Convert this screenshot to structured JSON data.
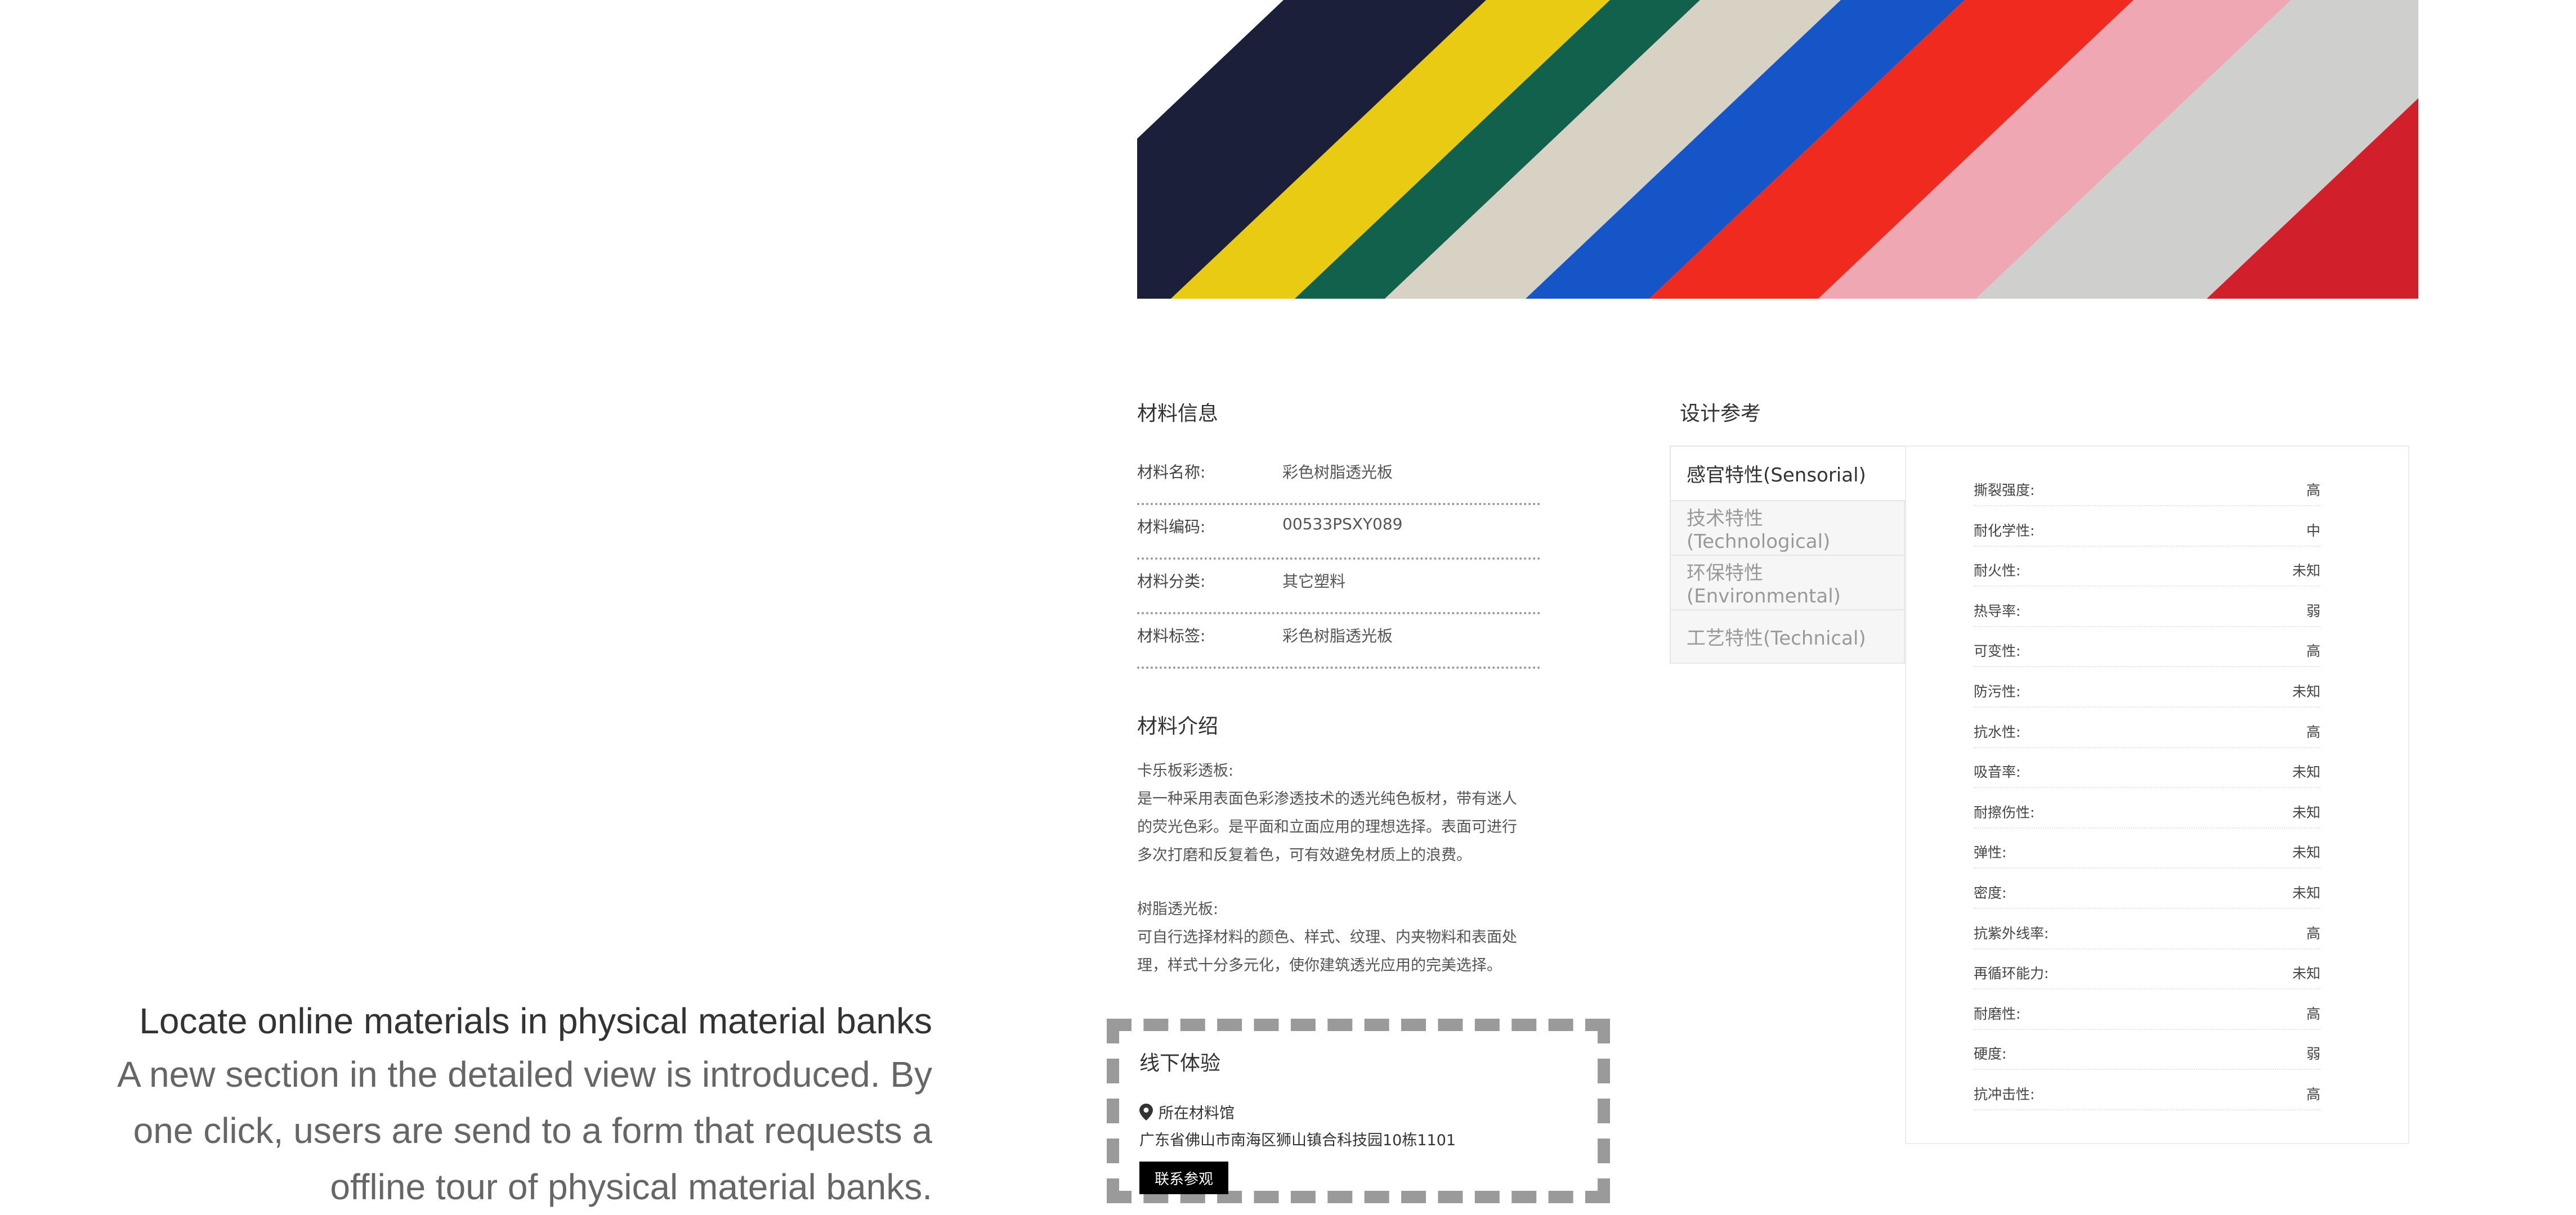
{
  "caption": {
    "title": "Locate online materials in physical material banks",
    "lines": [
      "A new section in the detailed view is introduced. By",
      "one click, users are send to a form that requests a",
      "offline tour of physical material banks."
    ]
  },
  "hero": {
    "stripe_colors": [
      "#1c1f3a",
      "#e9cb13",
      "#12614c",
      "#d7d2c4",
      "#1655c8",
      "#f12a1f",
      "#f0a7b4",
      "#cfd0cd",
      "#d21f2c"
    ]
  },
  "material_info": {
    "title": "材料信息",
    "rows": [
      {
        "label": "材料名称:",
        "value": "彩色树脂透光板"
      },
      {
        "label": "材料编码:",
        "value": "00533PSXY089"
      },
      {
        "label": "材料分类:",
        "value": "其它塑料"
      },
      {
        "label": "材料标签:",
        "value": "彩色树脂透光板"
      }
    ]
  },
  "material_intro": {
    "title": "材料介绍",
    "paragraphs": [
      [
        "卡乐板彩透板:",
        "是一种采用表面色彩渗透技术的透光纯色板材，带有迷人",
        "的荧光色彩。是平面和立面应用的理想选择。表面可进行",
        "多次打磨和反复着色，可有效避免材质上的浪费。"
      ],
      [
        "树脂透光板:",
        "可自行选择材料的颜色、样式、纹理、内夹物料和表面处",
        "理，样式十分多元化，使你建筑透光应用的完美选择。"
      ]
    ]
  },
  "offline": {
    "title": "线下体验",
    "location_label": "所在材料馆",
    "address": "广东省佛山市南海区狮山镇合科技园10栋1101",
    "contact_button": "联系参观"
  },
  "design_ref": {
    "title": "设计参考",
    "tabs": [
      {
        "label": "感官特性(Sensorial)",
        "active": true
      },
      {
        "label": "技术特性(Technological)",
        "active": false
      },
      {
        "label": "环保特性(Environmental)",
        "active": false
      },
      {
        "label": "工艺特性(Technical)",
        "active": false
      }
    ],
    "properties": [
      {
        "label": "撕裂强度:",
        "value": "高"
      },
      {
        "label": "耐化学性:",
        "value": "中"
      },
      {
        "label": "耐火性:",
        "value": "未知"
      },
      {
        "label": "热导率:",
        "value": "弱"
      },
      {
        "label": "可变性:",
        "value": "高"
      },
      {
        "label": "防污性:",
        "value": "未知"
      },
      {
        "label": "抗水性:",
        "value": "高"
      },
      {
        "label": "吸音率:",
        "value": "未知"
      },
      {
        "label": "耐擦伤性:",
        "value": "未知"
      },
      {
        "label": "弹性:",
        "value": "未知"
      },
      {
        "label": "密度:",
        "value": "未知"
      },
      {
        "label": "抗紫外线率:",
        "value": "高"
      },
      {
        "label": "再循环能力:",
        "value": "未知"
      },
      {
        "label": "耐磨性:",
        "value": "高"
      },
      {
        "label": "硬度:",
        "value": "弱"
      },
      {
        "label": "抗冲击性:",
        "value": "高"
      }
    ]
  }
}
